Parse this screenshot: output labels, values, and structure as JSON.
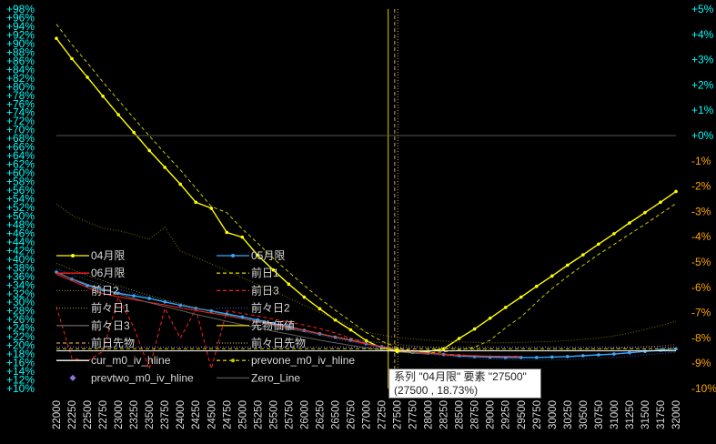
{
  "chart_data": {
    "type": "line",
    "x_categories": [
      22000,
      22250,
      22500,
      22750,
      23000,
      23250,
      23500,
      23750,
      24000,
      24250,
      24500,
      24750,
      25000,
      25250,
      25500,
      25750,
      26000,
      26250,
      26500,
      26750,
      27000,
      27250,
      27500,
      27750,
      28000,
      28250,
      28500,
      28750,
      29000,
      29250,
      29500,
      29750,
      30000,
      30250,
      30500,
      30750,
      31000,
      31250,
      31500,
      31750,
      32000
    ],
    "left_axis": {
      "min": 10,
      "max": 98,
      "step": 2,
      "format": "+{v}%",
      "color": "#00FFFF"
    },
    "right_axis": {
      "min": -10,
      "max": 5,
      "step": 1,
      "color_positive": "#00FFFF",
      "color_negative": "#FFA500"
    },
    "series": [
      {
        "name": "04月限",
        "color": "#FFFF00",
        "style": "solid-marker",
        "x": [
          22000,
          22250,
          22500,
          22750,
          23000,
          23250,
          23500,
          23750,
          24000,
          24250,
          24500,
          24750,
          25000,
          25250,
          25500,
          25750,
          26000,
          26250,
          26500,
          26750,
          27000,
          27250,
          27500,
          27750,
          28000,
          28250,
          28500,
          28750,
          29000,
          29250,
          29500,
          29750,
          30000,
          30250,
          30500,
          30750,
          31000,
          31250,
          31500,
          31750,
          32000
        ],
        "y": [
          91.2,
          86.5,
          82.2,
          77.8,
          73.5,
          69.4,
          65.2,
          61.3,
          57.4,
          53.2,
          51.8,
          46.2,
          45.1,
          40.9,
          37.5,
          34.2,
          31.2,
          28.5,
          25.9,
          23.6,
          21.1,
          19.4,
          18.73,
          18.4,
          18.6,
          19.2,
          21.6,
          23.8,
          26.3,
          28.8,
          31.2,
          33.7,
          36.1,
          38.6,
          41.0,
          43.5,
          45.9,
          48.4,
          50.8,
          53.2,
          55.7
        ]
      },
      {
        "name": "05月限",
        "color": "#39A8FF",
        "style": "solid-marker",
        "x": [
          22000,
          22250,
          22500,
          22750,
          23000,
          23250,
          23500,
          23750,
          24000,
          24250,
          24500,
          24750,
          25000,
          25250,
          25500,
          25750,
          26000,
          26250,
          26500,
          26750,
          27000,
          27250,
          27500,
          27750,
          28000,
          28250,
          28500,
          28750,
          29000,
          29250,
          29500,
          29750,
          30000,
          30250,
          30500,
          30750,
          31000,
          31250,
          31500,
          31750,
          32000
        ],
        "y": [
          37.0,
          35.4,
          33.9,
          32.9,
          32.1,
          31.5,
          30.9,
          30.1,
          29.3,
          28.6,
          28.0,
          27.3,
          26.6,
          25.9,
          25.1,
          24.3,
          23.5,
          22.7,
          21.9,
          21.2,
          20.4,
          19.7,
          19.1,
          18.6,
          18.2,
          17.9,
          17.6,
          17.4,
          17.3,
          17.2,
          17.2,
          17.2,
          17.3,
          17.4,
          17.6,
          17.8,
          18.0,
          18.3,
          18.6,
          18.9,
          19.2
        ]
      },
      {
        "name": "06月限",
        "color": "#FF2020",
        "style": "solid",
        "x": [
          22000,
          22250,
          22500,
          22750,
          23000,
          23250,
          23500,
          23750,
          24000,
          24250,
          24500,
          24750,
          25000,
          25250,
          25500,
          25750,
          26000,
          26250,
          26500,
          26750,
          27000,
          27250,
          27500,
          27750,
          28000,
          28250,
          28500,
          28750,
          29000,
          29250,
          29500
        ],
        "y": [
          36.5,
          35.0,
          33.4,
          32.0,
          31.3,
          30.6,
          30.0,
          29.4,
          28.7,
          28.1,
          27.5,
          26.9,
          26.2,
          25.6,
          24.9,
          24.2,
          23.5,
          22.7,
          21.9,
          21.1,
          20.4,
          19.7,
          19.0,
          18.6,
          18.2,
          17.9,
          17.7,
          17.6,
          17.5,
          17.5,
          17.4
        ]
      },
      {
        "name": "前日1",
        "color": "#C8C800",
        "style": "dashed",
        "x": [
          22000,
          22250,
          22500,
          22750,
          23000,
          23250,
          23500,
          23750,
          24000,
          24250,
          24500,
          24750,
          25000,
          25250,
          25500,
          25750,
          26000,
          26250,
          26500,
          26750,
          27000,
          27250,
          27500,
          27750,
          28000,
          28250,
          28500,
          28750,
          29000,
          29250,
          29500,
          29750,
          30000,
          30250,
          30500,
          30750,
          31000,
          31250,
          31500,
          31750,
          32000
        ],
        "y": [
          94.5,
          89.8,
          85.5,
          81.1,
          76.9,
          72.7,
          68.6,
          64.6,
          60.7,
          56.5,
          52.2,
          50.8,
          47.0,
          43.7,
          40.2,
          37.0,
          33.9,
          30.9,
          28.2,
          25.6,
          23.0,
          21.0,
          19.5,
          18.7,
          18.3,
          18.5,
          18.9,
          19.6,
          21.2,
          24.1,
          26.6,
          30.0,
          33.2,
          36.0,
          38.6,
          41.1,
          43.4,
          45.8,
          48.1,
          50.5,
          52.9
        ]
      },
      {
        "name": "前日2",
        "color": "#807000",
        "style": "dotted",
        "x": [
          22000,
          22250,
          22500,
          22750,
          23000,
          23250,
          23500,
          23750,
          24000,
          24250,
          24500,
          24750,
          25000,
          25250,
          25500,
          25750,
          26000,
          26250,
          26500,
          26750,
          27000,
          27250,
          27500,
          27750,
          28000,
          28250,
          28500,
          28750,
          29000,
          29250,
          29500,
          29750,
          30000,
          30250,
          30500,
          30750,
          31000,
          31250,
          31500,
          31750,
          32000
        ],
        "y": [
          52.8,
          50.2,
          48.6,
          47.2,
          46.6,
          45.7,
          44.6,
          47.4,
          41.9,
          40.4,
          38.9,
          37.3,
          35.7,
          34.1,
          32.6,
          31.0,
          29.3,
          27.7,
          26.1,
          24.6,
          23.1,
          22.4,
          21.8,
          21.5,
          21.2,
          21.0,
          20.8,
          20.7,
          20.6,
          20.6,
          20.7,
          20.8,
          20.9,
          21.1,
          21.4,
          21.7,
          22.2,
          22.9,
          23.7,
          24.6,
          25.6
        ]
      },
      {
        "name": "前日3",
        "color": "#FF2020",
        "style": "dashed",
        "x": [
          22000,
          22250,
          22500,
          22750,
          23000,
          23250,
          23500,
          23750,
          24000,
          24250,
          24500,
          24750,
          25000,
          25250,
          25500,
          25750,
          26000,
          26250,
          26500,
          26750,
          27000,
          27250,
          27500,
          27750,
          28000,
          28250,
          28500,
          28750,
          29000,
          29250,
          29500
        ],
        "y": [
          29.0,
          17.0,
          16.4,
          18.6,
          31.1,
          24.2,
          14.5,
          28.6,
          21.7,
          28.4,
          14.6,
          28.0,
          27.4,
          26.8,
          26.1,
          25.4,
          24.7,
          23.9,
          22.9,
          21.7,
          20.5,
          19.6,
          18.9,
          18.5,
          18.2,
          18.0,
          17.8,
          17.6,
          17.5,
          17.5,
          17.5
        ]
      },
      {
        "name": "前々日1",
        "color": "#8A8A20",
        "style": "dotted",
        "x": [
          22000,
          22250,
          22500,
          22750,
          23000,
          23250,
          23500,
          23750,
          24000,
          24250,
          24500,
          24750,
          25000,
          25250,
          25500,
          25750,
          26000,
          26250,
          26500,
          26750,
          27000,
          27250,
          27500,
          27750,
          28000,
          28250,
          28500,
          28750,
          29000,
          29250,
          29500,
          29750,
          30000,
          30250,
          30500,
          30750,
          31000,
          31250,
          31500,
          31750,
          32000
        ],
        "y": [
          39.0,
          37.6,
          36.2,
          35.0,
          33.8,
          32.7,
          31.6,
          30.6,
          29.7,
          28.7,
          27.8,
          27.0,
          26.2,
          25.4,
          24.6,
          23.9,
          23.2,
          22.6,
          22.0,
          21.5,
          21.0,
          20.6,
          20.2,
          19.9,
          19.6,
          19.4,
          19.2,
          19.0,
          18.9,
          18.8,
          18.8,
          18.8,
          18.8,
          18.9,
          19.0,
          19.1,
          19.3,
          19.5,
          19.7,
          19.9,
          20.2
        ]
      },
      {
        "name": "前々日2",
        "color": "#1E5AA8",
        "style": "dotted",
        "x": [
          22000,
          22250,
          22500,
          22750,
          23000,
          23250,
          23500,
          23750,
          24000,
          24250,
          24500,
          24750,
          25000,
          25250,
          25500,
          25750,
          26000,
          26250,
          26500,
          26750,
          27000,
          27250,
          27500,
          27750,
          28000,
          28250,
          28500,
          28750,
          29000,
          29250,
          29500,
          29750,
          30000,
          30250,
          30500,
          30750,
          31000,
          31250,
          31500,
          31750,
          32000
        ],
        "y": [
          37.8,
          36.4,
          35.2,
          34.0,
          33.0,
          32.1,
          31.2,
          30.3,
          29.5,
          28.7,
          27.9,
          27.1,
          26.3,
          25.5,
          24.7,
          23.9,
          23.1,
          22.3,
          21.5,
          20.8,
          20.1,
          19.5,
          18.9,
          18.4,
          18.0,
          17.6,
          17.3,
          17.0,
          16.8,
          16.7,
          16.6,
          16.6,
          16.6,
          16.7,
          16.8,
          17.0,
          17.2,
          17.5,
          17.8,
          18.1,
          18.4
        ]
      },
      {
        "name": "前々日3",
        "color": "#606060",
        "style": "solid",
        "x": [
          22000,
          22250,
          22500,
          22750,
          23000,
          23250,
          23500,
          23750,
          24000,
          24250,
          24500,
          24750,
          25000,
          25250,
          25500,
          25750,
          26000,
          26250,
          26500,
          26750,
          27000,
          27250,
          27500,
          27750,
          28000
        ],
        "y": [
          36.8,
          35.5,
          34.2,
          33.0,
          31.9,
          30.9,
          29.9,
          29.0,
          28.1,
          27.2,
          26.4,
          25.6,
          24.8,
          24.1,
          23.3,
          22.6,
          21.9,
          21.2,
          20.6,
          20.0,
          19.4,
          18.9,
          18.5,
          18.2,
          18.0
        ]
      },
      {
        "name": "先物価値",
        "color": "#E6C800",
        "style": "vline",
        "x_value": 27355
      },
      {
        "name": "前日先物",
        "color": "#C8A050",
        "style": "vline-dashed",
        "x_value": 27460
      },
      {
        "name": "前々日先物",
        "color": "#C8A050",
        "style": "vline-dotted",
        "x_value": 27510
      },
      {
        "name": "cur_m0_iv_hline",
        "color": "#FFFFFF",
        "style": "hline",
        "y_value": 18.73
      },
      {
        "name": "prevone_m0_iv_hline",
        "color": "#C8C800",
        "style": "hline-dashed",
        "y_value": 19.2
      },
      {
        "name": "prevtwo_m0_iv_hline",
        "color": "#9370DB",
        "style": "hline-dotted",
        "y_value": 19.6
      },
      {
        "name": "Zero_Line",
        "color": "#555555",
        "style": "hline-right",
        "y_value": 0
      }
    ],
    "legend": {
      "placement": "left",
      "items": [
        {
          "label": "04月限",
          "color": "#FFFF00",
          "kind": "line-marker"
        },
        {
          "label": "05月限",
          "color": "#39A8FF",
          "kind": "line-marker"
        },
        {
          "label": "06月限",
          "color": "#FF2020",
          "kind": "line"
        },
        {
          "label": "前日1",
          "color": "#C8C800",
          "kind": "dash"
        },
        {
          "label": "前日2",
          "color": "#807000",
          "kind": "dot"
        },
        {
          "label": "前日3",
          "color": "#FF2020",
          "kind": "dash"
        },
        {
          "label": "前々日1",
          "color": "#8A8A20",
          "kind": "dot"
        },
        {
          "label": "前々日2",
          "color": "#1E5AA8",
          "kind": "dot"
        },
        {
          "label": "前々日3",
          "color": "#606060",
          "kind": "line"
        },
        {
          "label": "先物価値",
          "color": "#E6C800",
          "kind": "line"
        },
        {
          "label": "前日先物",
          "color": "#C8A050",
          "kind": "dash"
        },
        {
          "label": "前々日先物",
          "color": "#C8A050",
          "kind": "dot"
        },
        {
          "label": "cur_m0_iv_hline",
          "color": "#FFFFFF",
          "kind": "line"
        },
        {
          "label": "prevone_m0_iv_hline",
          "color": "#C8C800",
          "kind": "dash-marker"
        },
        {
          "label": "prevtwo_m0_iv_hline",
          "color": "#9370DB",
          "kind": "diamond"
        },
        {
          "label": "Zero_Line",
          "color": "#555555",
          "kind": "line"
        }
      ]
    },
    "tooltip": {
      "line1": "系列 \"04月限\" 要素 \"27500\"",
      "line2": "(27500 , 18.73%)",
      "x_value": 27500,
      "y_value": 18.73
    }
  }
}
